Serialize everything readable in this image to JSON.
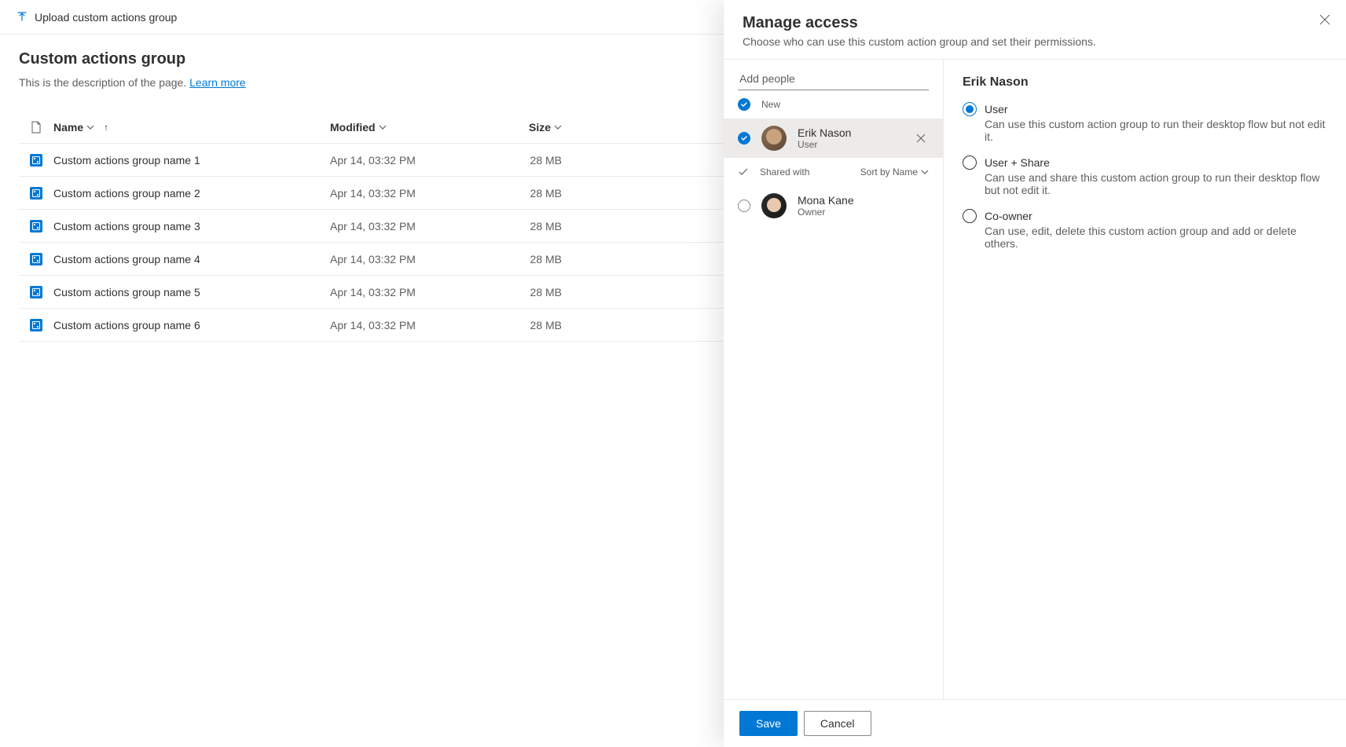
{
  "topbar": {
    "upload_label": "Upload custom actions group"
  },
  "page": {
    "title": "Custom actions group",
    "description": "This is the description of the page.",
    "learn_more": "Learn more"
  },
  "table": {
    "columns": {
      "name": "Name",
      "modified": "Modified",
      "size": "Size"
    },
    "rows": [
      {
        "name": "Custom actions group name 1",
        "modified": "Apr 14, 03:32 PM",
        "size": "28 MB"
      },
      {
        "name": "Custom actions group name 2",
        "modified": "Apr 14, 03:32 PM",
        "size": "28 MB"
      },
      {
        "name": "Custom actions group name 3",
        "modified": "Apr 14, 03:32 PM",
        "size": "28 MB"
      },
      {
        "name": "Custom actions group name 4",
        "modified": "Apr 14, 03:32 PM",
        "size": "28 MB"
      },
      {
        "name": "Custom actions group name 5",
        "modified": "Apr 14, 03:32 PM",
        "size": "28 MB"
      },
      {
        "name": "Custom actions group name 6",
        "modified": "Apr 14, 03:32 PM",
        "size": "28 MB"
      }
    ]
  },
  "panel": {
    "title": "Manage access",
    "subtitle": "Choose who can use this custom action group and set their permissions.",
    "add_people_placeholder": "Add people",
    "sections": {
      "new": "New",
      "shared": "Shared with",
      "sort_by": "Sort by Name"
    },
    "people": {
      "erik": {
        "name": "Erik Nason",
        "role": "User"
      },
      "mona": {
        "name": "Mona Kane",
        "role": "Owner"
      }
    },
    "details": {
      "selected_name": "Erik Nason",
      "options": [
        {
          "label": "User",
          "desc": "Can use this custom action group to run their desktop flow but not edit it."
        },
        {
          "label": "User + Share",
          "desc": "Can use and share this custom action group to run their desktop flow but not edit it."
        },
        {
          "label": "Co-owner",
          "desc": "Can use, edit, delete this custom action group and add or delete others."
        }
      ]
    },
    "footer": {
      "save": "Save",
      "cancel": "Cancel"
    }
  }
}
